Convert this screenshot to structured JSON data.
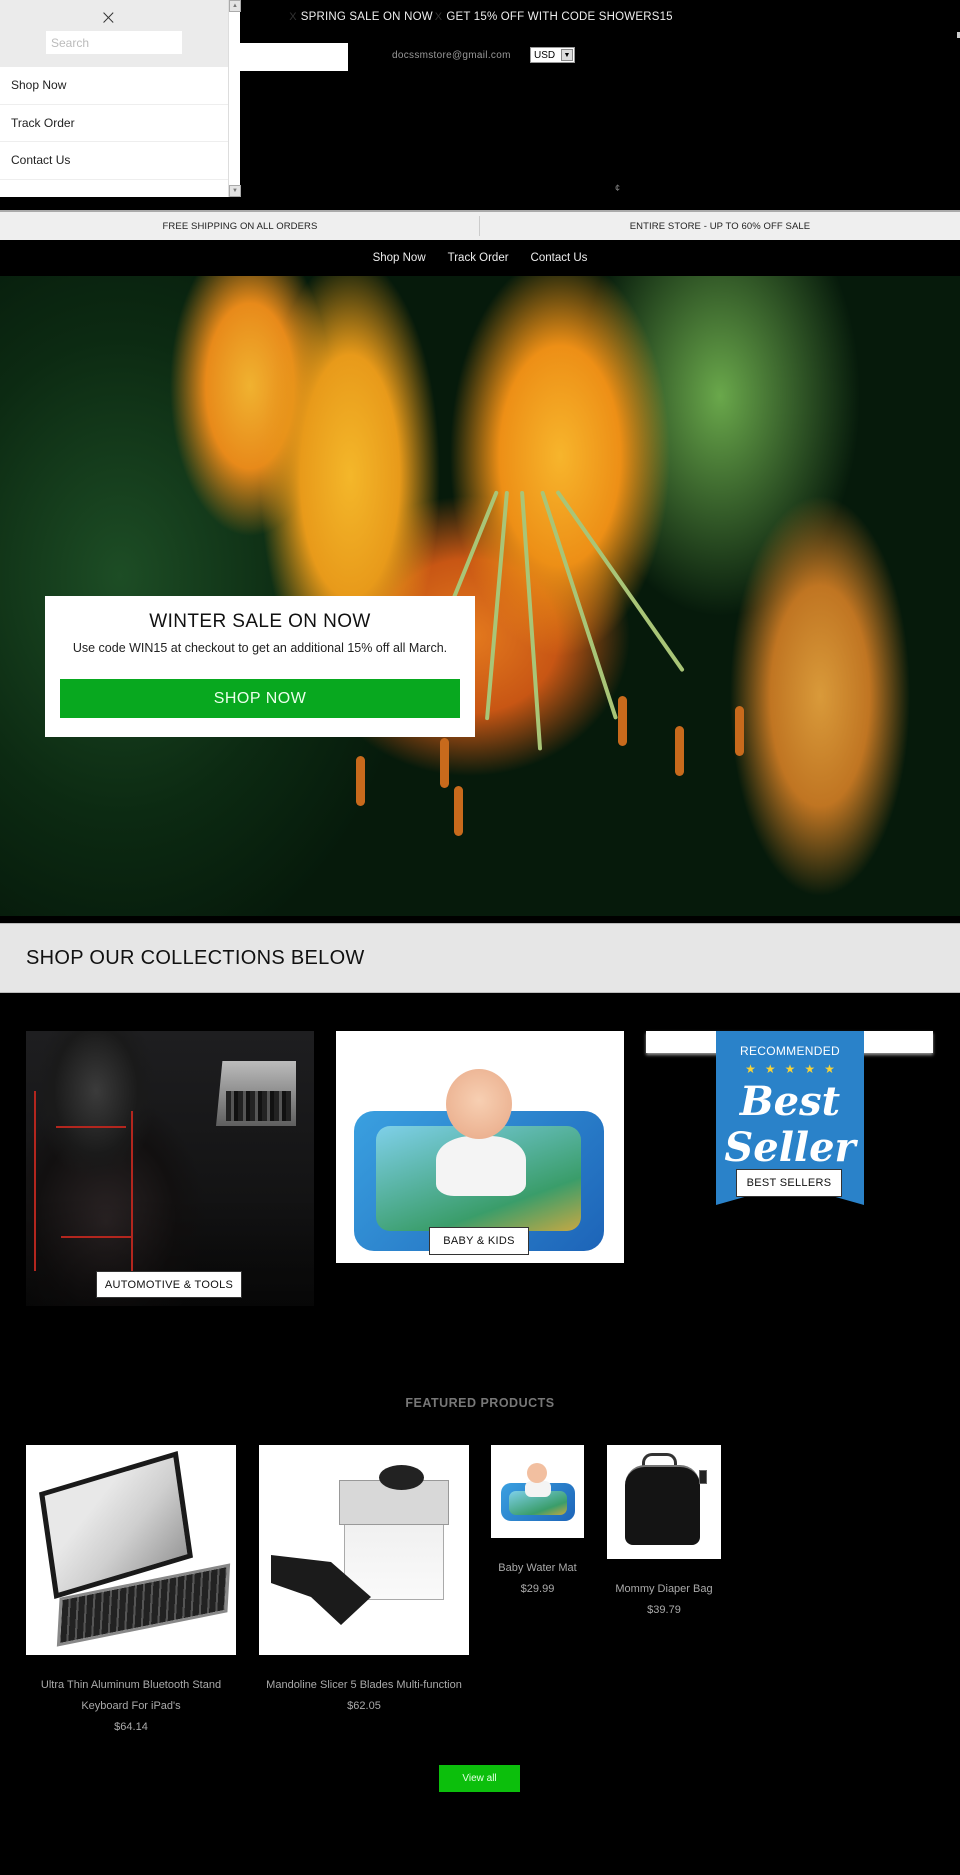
{
  "announcement": {
    "close_glyph": "X",
    "messages": [
      "SPRING SALE ON NOW",
      "GET 15% OFF WITH CODE SHOWERS15"
    ]
  },
  "header": {
    "email": "docssmstore@gmail.com",
    "currency": "USD",
    "small_glyph": "¢"
  },
  "drawer": {
    "close_icon": "×",
    "search_placeholder": "Search",
    "items": [
      {
        "label": "Shop Now"
      },
      {
        "label": "Track Order"
      },
      {
        "label": "Contact Us"
      }
    ],
    "scroll_up": "▲",
    "scroll_down": "▼"
  },
  "promo_bar": {
    "items": [
      "FREE SHIPPING ON ALL ORDERS",
      "ENTIRE STORE - UP TO 60% OFF SALE"
    ]
  },
  "nav": {
    "items": [
      {
        "label": "Shop Now"
      },
      {
        "label": "Track Order"
      },
      {
        "label": "Contact Us"
      }
    ]
  },
  "hero": {
    "title": "WINTER SALE ON NOW",
    "subtitle": "Use code WIN15 at checkout to get an additional 15% off all March.",
    "button_label": "SHOP NOW",
    "button_color": "#08a81f"
  },
  "collections": {
    "title": "SHOP OUR COLLECTIONS BELOW",
    "items": [
      {
        "label": "AUTOMOTIVE & TOOLS"
      },
      {
        "label": "BABY & KIDS"
      },
      {
        "label": "BEST SELLERS",
        "image_text": {
          "top": "RECOMMENDED",
          "stars": "★★★★★",
          "line1": "Best",
          "line2": "Seller"
        }
      }
    ]
  },
  "featured": {
    "title": "FEATURED PRODUCTS",
    "products": [
      {
        "name": "Ultra Thin Aluminum Bluetooth Stand Keyboard For iPad's",
        "price": "$64.14"
      },
      {
        "name": "Mandoline Slicer 5 Blades Multi-function",
        "price": "$62.05"
      },
      {
        "name": "Baby Water Mat",
        "price": "$29.99"
      },
      {
        "name": "Mommy Diaper Bag",
        "price": "$39.79"
      }
    ],
    "view_all_label": "View all",
    "view_all_color": "#0cbf0c"
  }
}
